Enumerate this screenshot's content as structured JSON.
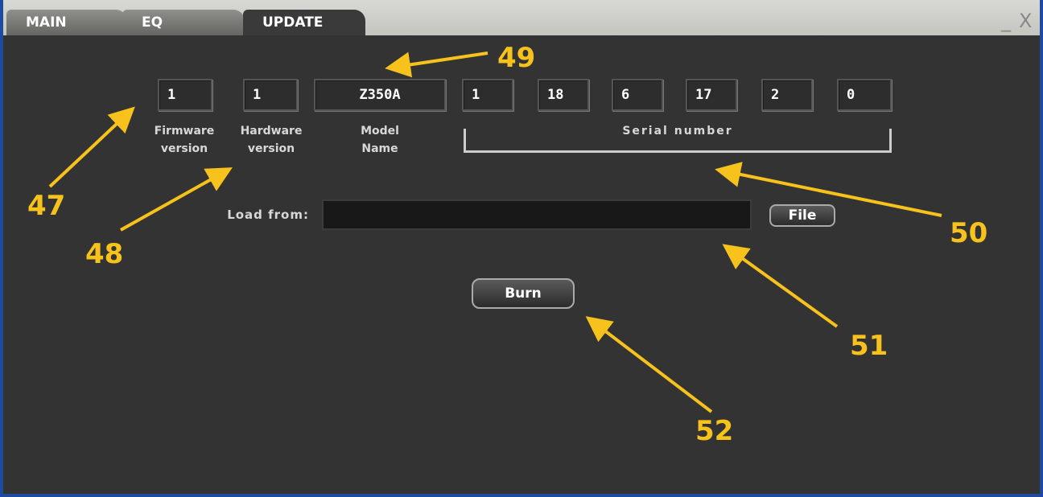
{
  "tabs": [
    {
      "label": "MAIN",
      "active": false
    },
    {
      "label": "EQ",
      "active": false
    },
    {
      "label": "UPDATE",
      "active": true
    }
  ],
  "window_controls": {
    "minimize": "_",
    "close": "X"
  },
  "fields": {
    "firmware_version": "1",
    "hardware_version": "1",
    "model_name": "Z350A",
    "serial_number": [
      "1",
      "18",
      "6",
      "17",
      "2",
      "0"
    ]
  },
  "labels": {
    "firmware_line1": "Firmware",
    "firmware_line2": "version",
    "hardware_line1": "Hardware",
    "hardware_line2": "version",
    "model_line1": "Model",
    "model_line2": "Name",
    "serial": "Serial number",
    "load_from": "Load from:"
  },
  "load": {
    "path_value": ""
  },
  "buttons": {
    "file": "File",
    "burn": "Burn"
  },
  "annotations": [
    "47",
    "48",
    "49",
    "50",
    "51",
    "52"
  ],
  "colors": {
    "annotation": "#f7c21c",
    "panel": "#333333",
    "window_border": "#1e4aa0"
  }
}
